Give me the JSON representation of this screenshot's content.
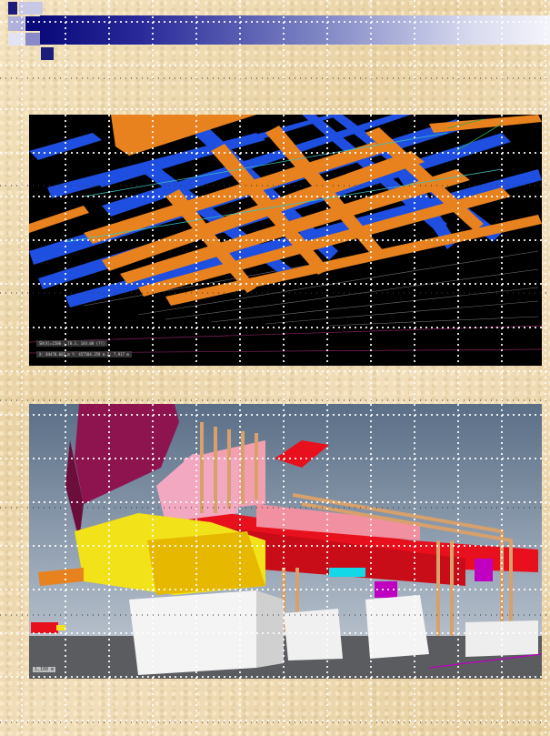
{
  "slide": {
    "readout_1": "SN(X)=1500 - 78.3, 144.00 (??)",
    "readout_2": "X: 84470.007 m  Y: 457504.359 m  Z: 7,917 m",
    "scale_label": "1,108 m"
  },
  "colors": {
    "title_gradient_start": "#0a0a7a",
    "title_gradient_end": "#f4f4fb",
    "background": "#efdcb3",
    "duct_blue": "#1f4fe0",
    "duct_orange": "#e8821e",
    "duct_red": "#e8101c",
    "duct_yellow": "#f2e21a",
    "duct_magenta": "#8e1450",
    "pipe_copper": "#d8a06a"
  }
}
